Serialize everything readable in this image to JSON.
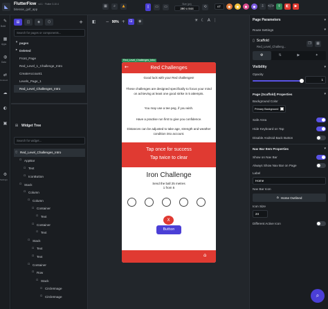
{
  "header": {
    "app_name": "FlutterFlow",
    "version": "v4.1 · Flutter 3.10.4",
    "project": "bitessie_golf_app",
    "size_label": "Size (px)",
    "size_value": "390 x 844",
    "version_select": "v7"
  },
  "rail": {
    "items": [
      "Build",
      "Apps",
      "Data",
      "Connect",
      "Settings"
    ]
  },
  "pages_panel": {
    "search_placeholder": "Search for pages or components...",
    "section_pages": "pages",
    "section_deleted": "Deleted",
    "items": [
      "Front_Page",
      "Red_Level_1_Challenge_Intro",
      "CreateAccount1",
      "Levels_Page_1",
      "Red_Level_Challenges_Intro"
    ],
    "selected_index": 4
  },
  "widget_tree": {
    "title": "Widget Tree",
    "search_placeholder": "Search for widget...",
    "nodes": [
      {
        "label": "Red_Level_Challenges_Intro",
        "indent": 0,
        "selected": true
      },
      {
        "label": "AppBar",
        "indent": 1
      },
      {
        "label": "Text",
        "indent": 2
      },
      {
        "label": "IconButton",
        "indent": 2
      },
      {
        "label": "Stack",
        "indent": 1
      },
      {
        "label": "Column",
        "indent": 2
      },
      {
        "label": "Column",
        "indent": 3
      },
      {
        "label": "Container",
        "indent": 4
      },
      {
        "label": "Text",
        "indent": 5
      },
      {
        "label": "Container",
        "indent": 4
      },
      {
        "label": "Text",
        "indent": 5
      },
      {
        "label": "Stack",
        "indent": 3
      },
      {
        "label": "Text",
        "indent": 4
      },
      {
        "label": "Text",
        "indent": 4
      },
      {
        "label": "Container",
        "indent": 3
      },
      {
        "label": "Row",
        "indent": 4
      },
      {
        "label": "Stack",
        "indent": 5
      },
      {
        "label": "CircleImage",
        "indent": 6
      },
      {
        "label": "CircleImage",
        "indent": 6
      }
    ]
  },
  "canvas": {
    "zoom": "90%",
    "badge": "Red_Level_Challenges_Intro"
  },
  "phone": {
    "appbar_title": "Red Challenges",
    "intro": "Good luck with your Red challenges!",
    "para1": "These challenges are designed specifically to focus your mind on achieving at least one good strike in 5 attempts.",
    "para2": "You may use a tee peg, if you wish.",
    "para3": "Have a practise run first to give you confidence.",
    "para4": "Distances can be adjusted to take age, strength and weather condition into account.",
    "tap_line1": "Tap once for success",
    "tap_line2": "Tap twice to clear",
    "challenge_title": "Iron Challenge",
    "challenge_sub1": "Send the ball 25 metres",
    "challenge_sub2": "1 from 5",
    "close_glyph": "X",
    "button_label": "Button"
  },
  "props": {
    "title": "Page Parameters",
    "route_label": "Route Settings",
    "widget_type": "Scaffold",
    "widget_name": "Red_Level_Challeng...",
    "visibility": "Visibility",
    "opacity_label": "Opacity",
    "opacity_value": "1",
    "opacity_level": 1,
    "page_props": "Page (Scaffold) Properties",
    "bg_color_label": "Background Color",
    "bg_color_value": "Primary Background",
    "safe_area": "Safe Area",
    "hide_keyboard": "Hide Keyboard on Tap",
    "disable_back": "Disable Android Back Button",
    "nav_props": "Nav Bar Item Properties",
    "show_nav": "Show on Nav Bar",
    "always_show": "Always Show Nav Bar on Page",
    "label_label": "Label",
    "label_value": "Home",
    "nav_icon": "Nav Bar Icon",
    "icon_value": "Home Outlined",
    "icon_size_label": "Icon Size",
    "icon_size_value": "24",
    "diff_active": "Different Active Icon"
  },
  "colors": {
    "accent": "#4b3fd6",
    "red": "#e03a32",
    "purple_button": "#4b3fd6"
  }
}
